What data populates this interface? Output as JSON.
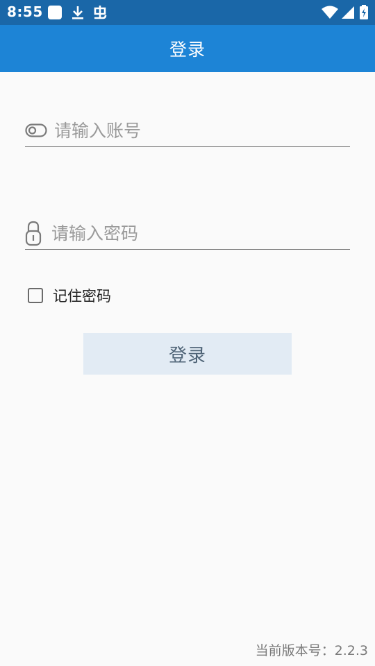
{
  "status_bar": {
    "time": "8:55",
    "icons": [
      "notification-square-icon",
      "download-icon",
      "bug-icon",
      "wifi-icon",
      "signal-icon",
      "battery-icon"
    ]
  },
  "app_bar": {
    "title": "登录"
  },
  "form": {
    "account_placeholder": "请输入账号",
    "account_value": "",
    "password_placeholder": "请输入密码",
    "password_value": "",
    "remember_label": "记住密码",
    "remember_checked": false,
    "login_label": "登录"
  },
  "footer": {
    "version_text": "当前版本号：2.2.3"
  },
  "colors": {
    "status_bar": "#1a67a8",
    "app_bar": "#1d84d6",
    "button_bg": "#e2ebf4",
    "button_text": "#4e6376"
  }
}
